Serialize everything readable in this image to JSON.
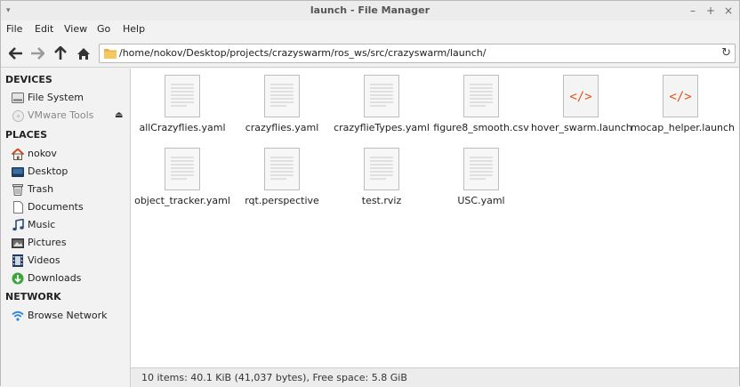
{
  "window": {
    "title": "launch - File Manager",
    "menu_glyph": "▾",
    "minimize": "–",
    "maximize": "+",
    "close": "×"
  },
  "menubar": [
    "File",
    "Edit",
    "View",
    "Go",
    "Help"
  ],
  "toolbar": {
    "back_icon": "back-arrow-icon",
    "forward_icon": "forward-arrow-icon",
    "up_icon": "up-arrow-icon",
    "home_icon": "home-icon",
    "location": "/home/nokov/Desktop/projects/crazyswarm/ros_ws/src/crazyswarm/launch/",
    "reload": "↻"
  },
  "sidebar": {
    "devices_label": "DEVICES",
    "devices": [
      {
        "label": "File System",
        "icon": "drive-icon"
      },
      {
        "label": "VMware Tools",
        "icon": "disc-icon",
        "eject": "⏏"
      }
    ],
    "places_label": "PLACES",
    "places": [
      {
        "label": "nokov",
        "icon": "home-icon"
      },
      {
        "label": "Desktop",
        "icon": "desktop-icon"
      },
      {
        "label": "Trash",
        "icon": "trash-icon"
      },
      {
        "label": "Documents",
        "icon": "document-icon"
      },
      {
        "label": "Music",
        "icon": "music-icon"
      },
      {
        "label": "Pictures",
        "icon": "pictures-icon"
      },
      {
        "label": "Videos",
        "icon": "videos-icon"
      },
      {
        "label": "Downloads",
        "icon": "downloads-icon"
      }
    ],
    "network_label": "NETWORK",
    "network": [
      {
        "label": "Browse Network",
        "icon": "network-icon"
      }
    ]
  },
  "files": [
    {
      "name": "allCrazyflies.yaml",
      "type": "text"
    },
    {
      "name": "crazyflies.yaml",
      "type": "text"
    },
    {
      "name": "crazyflieTypes.yaml",
      "type": "text"
    },
    {
      "name": "figure8_smooth.csv",
      "type": "text"
    },
    {
      "name": "hover_swarm.launch",
      "type": "code",
      "glyph": "</>"
    },
    {
      "name": "mocap_helper.launch",
      "type": "code",
      "glyph": "</>"
    },
    {
      "name": "object_tracker.yaml",
      "type": "text"
    },
    {
      "name": "rqt.perspective",
      "type": "text"
    },
    {
      "name": "test.rviz",
      "type": "text"
    },
    {
      "name": "USC.yaml",
      "type": "text"
    }
  ],
  "status": "10 items: 40.1 KiB (41,037 bytes), Free space: 5.8 GiB",
  "colors": {
    "code_accent": "#e0561b",
    "folder": "#e8b44a",
    "home_roof": "#d8481f"
  }
}
